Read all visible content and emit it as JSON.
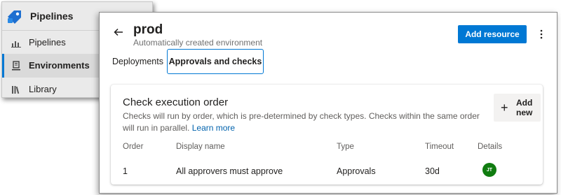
{
  "sidebar": {
    "app_title": "Pipelines",
    "items": [
      {
        "label": "Pipelines",
        "icon": "pipelines-icon"
      },
      {
        "label": "Environments",
        "icon": "environments-icon",
        "active": true
      },
      {
        "label": "Library",
        "icon": "library-icon"
      }
    ]
  },
  "header": {
    "title": "prod",
    "subtitle": "Automatically created environment",
    "add_resource_label": "Add resource",
    "more_icon": "more-vertical-icon",
    "back_icon": "back-arrow-icon"
  },
  "tabs": [
    {
      "label": "Deployments"
    },
    {
      "label": "Approvals and checks",
      "selected": true
    }
  ],
  "card": {
    "title": "Check execution order",
    "description": "Checks will run by order, which is pre-determined by check types. Checks within the same order will run in parallel.",
    "learn_more": "Learn more",
    "add_new_label": "Add new",
    "columns": [
      "Order",
      "Display name",
      "Type",
      "Timeout",
      "Details"
    ],
    "rows": [
      {
        "order": "1",
        "display_name": "All approvers must approve",
        "type": "Approvals",
        "timeout": "30d",
        "details_avatar": "JT"
      }
    ]
  },
  "colors": {
    "accent": "#0078d4",
    "avatar_bg": "#107c10",
    "link": "#0062ad"
  }
}
